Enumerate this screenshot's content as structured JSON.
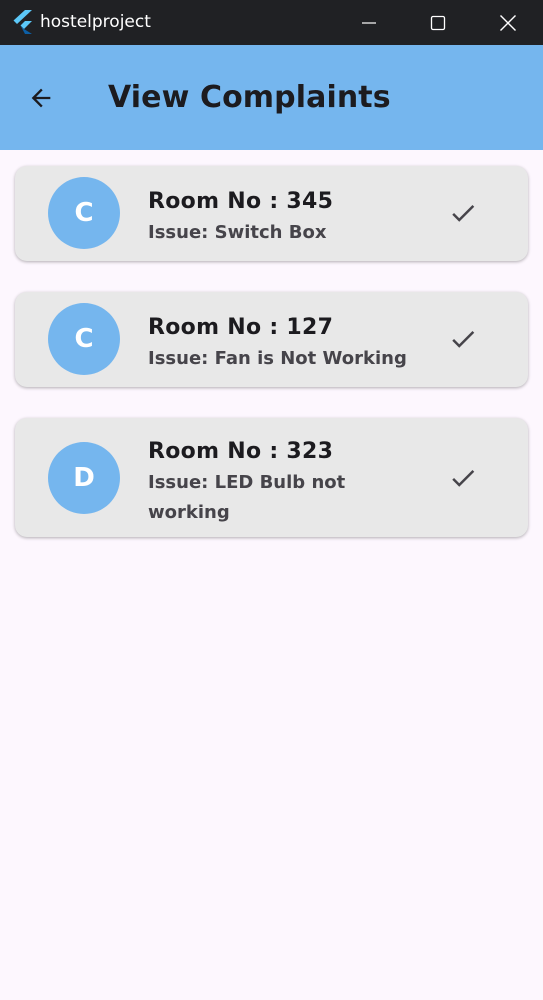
{
  "window": {
    "title": "hostelproject",
    "controls": [
      "minimize",
      "maximize",
      "close"
    ]
  },
  "appbar": {
    "back_icon": "arrow-left-icon",
    "title": "View Complaints"
  },
  "complaints": [
    {
      "initial": "C",
      "room": "Room No : 345",
      "issue": "Issue: Switch Box",
      "action_icon": "check-icon"
    },
    {
      "initial": "C",
      "room": "Room No : 127",
      "issue": "Issue: Fan is Not Working",
      "action_icon": "check-icon"
    },
    {
      "initial": "D",
      "room": "Room No : 323",
      "issue": "Issue: LED Bulb not working",
      "action_icon": "check-icon"
    }
  ],
  "colors": {
    "titlebar": "#202124",
    "appbar": "#75b6ee",
    "avatar": "#75b6ee",
    "card": "#e8e8e8",
    "background": "#fdf7fe"
  }
}
